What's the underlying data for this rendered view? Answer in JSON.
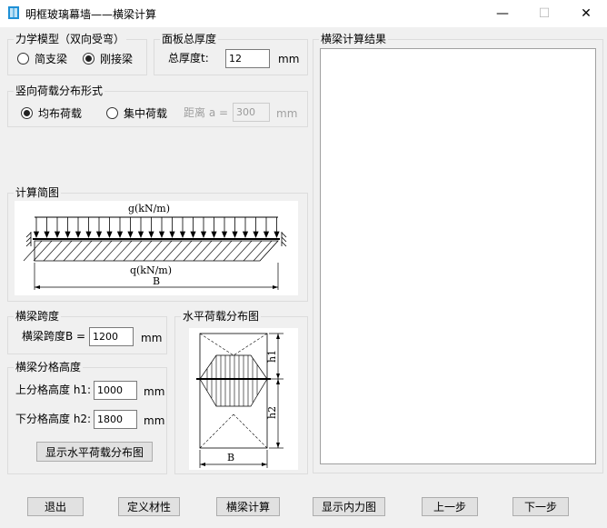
{
  "window": {
    "title": "明框玻璃幕墙——横梁计算",
    "minimize_glyph": "—",
    "maximize_glyph": "☐",
    "close_glyph": "✕"
  },
  "mechanics_model": {
    "title": "力学模型（双向受弯）",
    "options": [
      {
        "label": "简支梁",
        "selected": false
      },
      {
        "label": "刚接梁",
        "selected": true
      }
    ]
  },
  "panel_thickness": {
    "title": "面板总厚度",
    "label": "总厚度t:",
    "value": "12",
    "unit": "mm"
  },
  "vertical_load": {
    "title": "竖向荷载分布形式",
    "options": [
      {
        "label": "均布荷载",
        "selected": true
      },
      {
        "label": "集中荷载",
        "selected": false
      }
    ],
    "distance_label": "距离 a =",
    "distance_value": "300",
    "distance_unit": "mm"
  },
  "calc_diagram": {
    "title": "计算简图",
    "g_label": "g(kN/m)",
    "q_label": "q(kN/m)",
    "b_label": "B"
  },
  "beam_span": {
    "title": "横梁跨度",
    "label": "横梁跨度B =",
    "value": "1200",
    "unit": "mm"
  },
  "division_height": {
    "title": "横梁分格高度",
    "upper_label": "上分格高度 h1:",
    "upper_value": "1000",
    "upper_unit": "mm",
    "lower_label": "下分格高度 h2:",
    "lower_value": "1800",
    "lower_unit": "mm",
    "show_button": "显示水平荷载分布图"
  },
  "horizontal_load": {
    "title": "水平荷载分布图",
    "h1_label": "h1",
    "h2_label": "h2",
    "b_label": "B"
  },
  "results": {
    "title": "横梁计算结果"
  },
  "footer": {
    "exit": "退出",
    "define_material": "定义材性",
    "beam_calc": "横梁计算",
    "show_internal_force": "显示内力图",
    "prev": "上一步",
    "next": "下一步"
  },
  "colors": {
    "window_bg": "#f0f0f0",
    "titlebar_bg": "#ffffff",
    "icon_blue": "#1e90d6"
  }
}
